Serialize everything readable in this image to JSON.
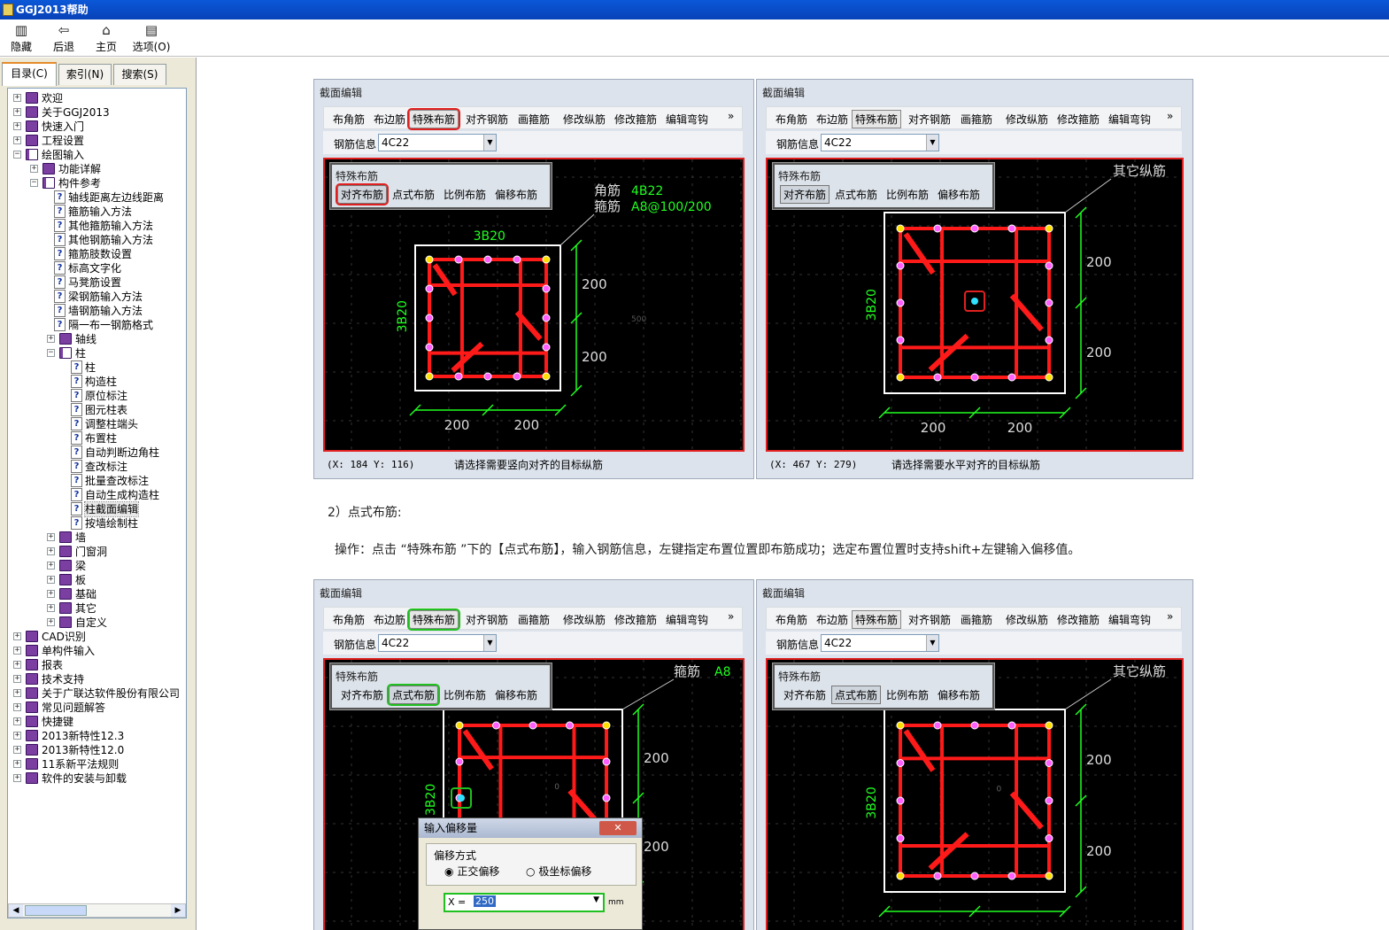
{
  "window": {
    "title": "GGJ2013帮助"
  },
  "toolbar": {
    "hide": "隐藏",
    "back": "后退",
    "home": "主页",
    "options": "选项(O)"
  },
  "tabs": {
    "contents": "目录(C)",
    "index": "索引(N)",
    "search": "搜索(S)"
  },
  "tree": [
    {
      "label": "欢迎",
      "level": 0,
      "kind": "book",
      "expander": "+"
    },
    {
      "label": "关于GGJ2013",
      "level": 0,
      "kind": "book",
      "expander": "+"
    },
    {
      "label": "快速入门",
      "level": 0,
      "kind": "book",
      "expander": "+"
    },
    {
      "label": "工程设置",
      "level": 0,
      "kind": "book",
      "expander": "+"
    },
    {
      "label": "绘图输入",
      "level": 0,
      "kind": "book-open",
      "expander": "-"
    },
    {
      "label": "功能详解",
      "level": 1,
      "kind": "book",
      "expander": "+"
    },
    {
      "label": "构件参考",
      "level": 1,
      "kind": "book-open",
      "expander": "-"
    },
    {
      "label": "轴线距离左边线距离",
      "level": 2,
      "kind": "page"
    },
    {
      "label": "箍筋输入方法",
      "level": 2,
      "kind": "page"
    },
    {
      "label": "其他箍筋输入方法",
      "level": 2,
      "kind": "page"
    },
    {
      "label": "其他钢筋输入方法",
      "level": 2,
      "kind": "page"
    },
    {
      "label": "箍筋肢数设置",
      "level": 2,
      "kind": "page"
    },
    {
      "label": "标高文字化",
      "level": 2,
      "kind": "page"
    },
    {
      "label": "马凳筋设置",
      "level": 2,
      "kind": "page"
    },
    {
      "label": "梁钢筋输入方法",
      "level": 2,
      "kind": "page"
    },
    {
      "label": "墙钢筋输入方法",
      "level": 2,
      "kind": "page"
    },
    {
      "label": "隔一布一钢筋格式",
      "level": 2,
      "kind": "page"
    },
    {
      "label": "轴线",
      "level": 2,
      "kind": "book",
      "expander": "+"
    },
    {
      "label": "柱",
      "level": 2,
      "kind": "book-open",
      "expander": "-"
    },
    {
      "label": "柱",
      "level": 3,
      "kind": "page"
    },
    {
      "label": "构造柱",
      "level": 3,
      "kind": "page"
    },
    {
      "label": "原位标注",
      "level": 3,
      "kind": "page"
    },
    {
      "label": "图元柱表",
      "level": 3,
      "kind": "page"
    },
    {
      "label": "调整柱端头",
      "level": 3,
      "kind": "page"
    },
    {
      "label": "布置柱",
      "level": 3,
      "kind": "page"
    },
    {
      "label": "自动判断边角柱",
      "level": 3,
      "kind": "page"
    },
    {
      "label": "查改标注",
      "level": 3,
      "kind": "page"
    },
    {
      "label": "批量查改标注",
      "level": 3,
      "kind": "page"
    },
    {
      "label": "自动生成构造柱",
      "level": 3,
      "kind": "page"
    },
    {
      "label": "柱截面编辑",
      "level": 3,
      "kind": "page",
      "selected": true
    },
    {
      "label": "按墙绘制柱",
      "level": 3,
      "kind": "page"
    },
    {
      "label": "墙",
      "level": 2,
      "kind": "book",
      "expander": "+"
    },
    {
      "label": "门窗洞",
      "level": 2,
      "kind": "book",
      "expander": "+"
    },
    {
      "label": "梁",
      "level": 2,
      "kind": "book",
      "expander": "+"
    },
    {
      "label": "板",
      "level": 2,
      "kind": "book",
      "expander": "+"
    },
    {
      "label": "基础",
      "level": 2,
      "kind": "book",
      "expander": "+"
    },
    {
      "label": "其它",
      "level": 2,
      "kind": "book",
      "expander": "+"
    },
    {
      "label": "自定义",
      "level": 2,
      "kind": "book",
      "expander": "+"
    },
    {
      "label": "CAD识别",
      "level": 0,
      "kind": "book",
      "expander": "+"
    },
    {
      "label": "单构件输入",
      "level": 0,
      "kind": "book",
      "expander": "+"
    },
    {
      "label": "报表",
      "level": 0,
      "kind": "book",
      "expander": "+"
    },
    {
      "label": "技术支持",
      "level": 0,
      "kind": "book",
      "expander": "+"
    },
    {
      "label": "关于广联达软件股份有限公司",
      "level": 0,
      "kind": "book",
      "expander": "+"
    },
    {
      "label": "常见问题解答",
      "level": 0,
      "kind": "book",
      "expander": "+"
    },
    {
      "label": "快捷键",
      "level": 0,
      "kind": "book",
      "expander": "+"
    },
    {
      "label": "2013新特性12.3",
      "level": 0,
      "kind": "book",
      "expander": "+"
    },
    {
      "label": "2013新特性12.0",
      "level": 0,
      "kind": "book",
      "expander": "+"
    },
    {
      "label": "11系新平法规则",
      "level": 0,
      "kind": "book",
      "expander": "+"
    },
    {
      "label": "软件的安装与卸载",
      "level": 0,
      "kind": "book",
      "expander": "+"
    }
  ],
  "panel_common": {
    "title": "截面编辑",
    "tools": [
      "布角筋",
      "布边筋",
      "特殊布筋",
      "对齐钢筋",
      "画箍筋",
      "修改纵筋",
      "修改箍筋",
      "编辑弯钩"
    ],
    "more": "»",
    "rebar_label": "钢筋信息",
    "rebar_value": "4C22",
    "popup_title": "特殊布筋",
    "popup_items": [
      "对齐布筋",
      "点式布筋",
      "比例布筋",
      "偏移布筋"
    ]
  },
  "panels": [
    {
      "coords": "(X: 184 Y: 116)",
      "status": "请选择需要竖向对齐的目标纵筋",
      "labels": {
        "corner": "角筋",
        "stirrup": "箍筋",
        "corner_val": "4B22",
        "stirrup_val": "A8@100/200",
        "top": "3B20",
        "side": "3B20",
        "dim1": "200",
        "dim2": "200",
        "dim3": "200",
        "dim4": "200",
        "mid": "500"
      }
    },
    {
      "coords": "(X: 467 Y: 279)",
      "status": "请选择需要水平对齐的目标纵筋",
      "labels": {
        "other": "其它纵筋",
        "side": "3B20",
        "dim1": "200",
        "dim2": "200",
        "dim3": "200",
        "dim4": "200"
      }
    },
    {
      "labels": {
        "stirrup": "箍筋",
        "stirrup_val": "A8",
        "side": "3B20",
        "dim1": "200",
        "dim2": "200",
        "zero": "0"
      }
    },
    {
      "labels": {
        "other": "其它纵筋",
        "side": "3B20",
        "dim1": "200",
        "dim2": "200",
        "zero": "0"
      }
    }
  ],
  "text": {
    "heading": "2）点式布筋:",
    "operation": "操作：点击 “特殊布筋 ”下的【点式布筋】，输入钢筋信息，左键指定布置位置即布筋成功；选定布置位置时支持shift+左键输入偏移值。"
  },
  "dialog": {
    "title": "输入偏移量",
    "group": "偏移方式",
    "radio1": "正交偏移",
    "radio2": "极坐标偏移",
    "x_label": "X =",
    "x_value": "250",
    "unit": "mm"
  },
  "colors": {
    "highlight_red": "#e02020",
    "highlight_green": "#20c020",
    "rebar": "#ff1a1a",
    "dim": "#20ff20"
  }
}
